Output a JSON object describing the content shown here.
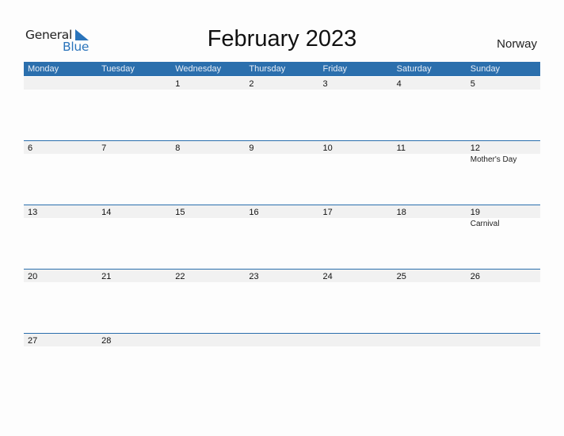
{
  "logo": {
    "word1": "General",
    "word2": "Blue"
  },
  "title": "February 2023",
  "country": "Norway",
  "colors": {
    "header_bg": "#2b6fad",
    "strip_bg": "#f1f1f1",
    "logo_blue": "#2a74bb"
  },
  "weekdays": [
    "Monday",
    "Tuesday",
    "Wednesday",
    "Thursday",
    "Friday",
    "Saturday",
    "Sunday"
  ],
  "weeks": [
    [
      {
        "day": "",
        "event": ""
      },
      {
        "day": "",
        "event": ""
      },
      {
        "day": "1",
        "event": ""
      },
      {
        "day": "2",
        "event": ""
      },
      {
        "day": "3",
        "event": ""
      },
      {
        "day": "4",
        "event": ""
      },
      {
        "day": "5",
        "event": ""
      }
    ],
    [
      {
        "day": "6",
        "event": ""
      },
      {
        "day": "7",
        "event": ""
      },
      {
        "day": "8",
        "event": ""
      },
      {
        "day": "9",
        "event": ""
      },
      {
        "day": "10",
        "event": ""
      },
      {
        "day": "11",
        "event": ""
      },
      {
        "day": "12",
        "event": "Mother's Day"
      }
    ],
    [
      {
        "day": "13",
        "event": ""
      },
      {
        "day": "14",
        "event": ""
      },
      {
        "day": "15",
        "event": ""
      },
      {
        "day": "16",
        "event": ""
      },
      {
        "day": "17",
        "event": ""
      },
      {
        "day": "18",
        "event": ""
      },
      {
        "day": "19",
        "event": "Carnival"
      }
    ],
    [
      {
        "day": "20",
        "event": ""
      },
      {
        "day": "21",
        "event": ""
      },
      {
        "day": "22",
        "event": ""
      },
      {
        "day": "23",
        "event": ""
      },
      {
        "day": "24",
        "event": ""
      },
      {
        "day": "25",
        "event": ""
      },
      {
        "day": "26",
        "event": ""
      }
    ],
    [
      {
        "day": "27",
        "event": ""
      },
      {
        "day": "28",
        "event": ""
      },
      {
        "day": "",
        "event": ""
      },
      {
        "day": "",
        "event": ""
      },
      {
        "day": "",
        "event": ""
      },
      {
        "day": "",
        "event": ""
      },
      {
        "day": "",
        "event": ""
      }
    ]
  ]
}
